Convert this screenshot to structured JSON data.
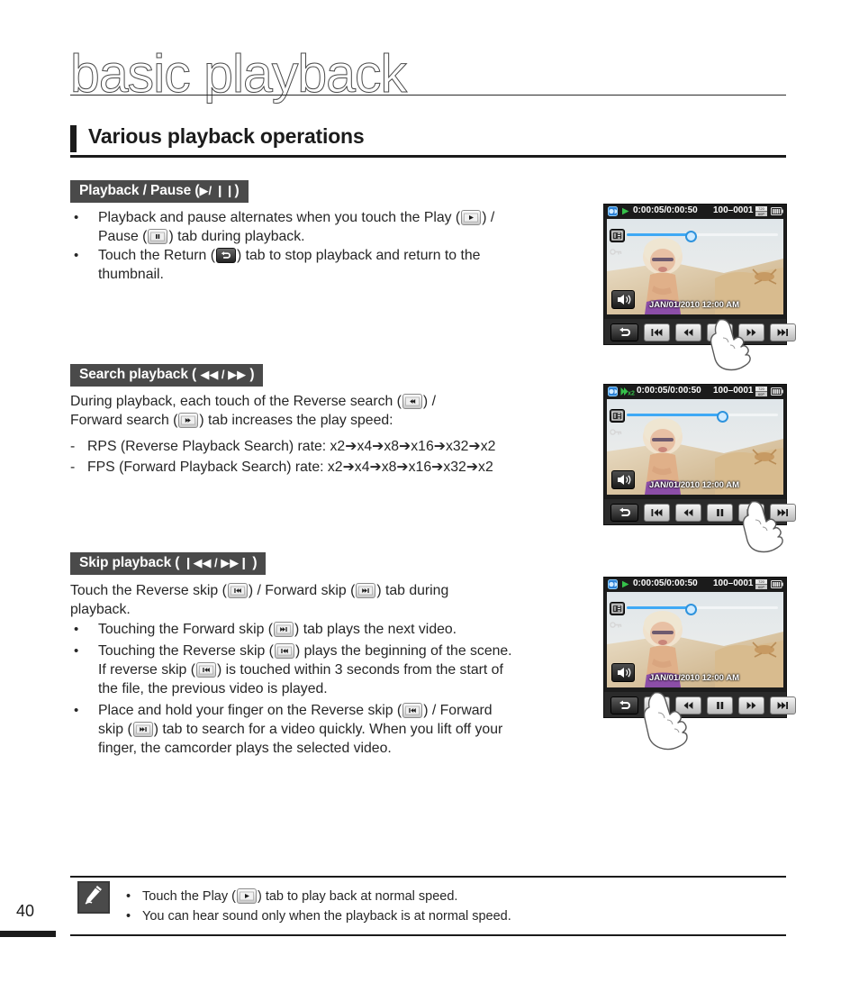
{
  "chapter": {
    "title": "basic playback"
  },
  "section": {
    "title": "Various playback operations"
  },
  "page": {
    "number": "40"
  },
  "subsections": [
    {
      "id": "playback-pause",
      "pill_label": "Playback / Pause (",
      "pill_glyphs": "▶/ ❙❙",
      "pill_close": ")",
      "bullets": [
        {
          "parts": [
            "Playback and pause alternates when you touch the Play (",
            ") /",
            "Pause (",
            ") tab during playback."
          ]
        },
        {
          "parts": [
            "Touch the Return (",
            ") tab to stop playback and return to the",
            "thumbnail."
          ]
        }
      ]
    },
    {
      "id": "search-playback",
      "pill_label": "Search playback ( ",
      "pill_glyphs": "◀◀ / ▶▶",
      "pill_close": " )",
      "intro": [
        "During playback, each touch of the Reverse search (",
        ") /",
        "Forward search (",
        ") tab increases the play speed:"
      ],
      "dashes": [
        "RPS (Reverse Playback Search) rate: x2➔x4➔x8➔x16➔x32➔x2",
        "FPS (Forward Playback Search) rate: x2➔x4➔x8➔x16➔x32➔x2"
      ]
    },
    {
      "id": "skip-playback",
      "pill_label": "Skip playback ( ",
      "pill_glyphs": "❙◀◀ / ▶▶❙",
      "pill_close": " )",
      "intro": [
        "Touch the Reverse skip (",
        ") / Forward skip (",
        ") tab during",
        "playback."
      ],
      "bullets": [
        {
          "parts": [
            "Touching the Forward skip (",
            ") tab plays the next video."
          ]
        },
        {
          "parts": [
            "Touching the Reverse skip (",
            ") plays the beginning of the scene.",
            "If reverse skip (",
            ") is touched within 3 seconds from the start of",
            "the file, the previous video is played."
          ]
        },
        {
          "parts": [
            "Place and hold your finger on the Reverse skip (",
            ") / Forward",
            "skip (",
            ") tab to search for a video quickly. When you lift off your",
            "finger, the camcorder plays the selected video."
          ]
        }
      ]
    }
  ],
  "lcd": {
    "time": "0:00:05/0:00:50",
    "file_no": "100–0001",
    "resolution_badge": "720\n60P",
    "date_overlay": "JAN/01/2010  12:00 AM",
    "speed_badge": "x2",
    "buttons": [
      "return-tab",
      "reverse-skip-tab",
      "reverse-search-tab",
      "pause-tab",
      "forward-search-tab",
      "forward-skip-tab"
    ]
  },
  "lcd_screens": [
    {
      "id": "screen-playback-pause",
      "status_icon": "play-icon",
      "touched_button": "pause-tab"
    },
    {
      "id": "screen-search-playback",
      "status_icon": "forward-search-x2-icon",
      "touched_button": "forward-search-tab"
    },
    {
      "id": "screen-skip-playback",
      "status_icon": "play-icon",
      "touched_button": "reverse-skip-tab"
    }
  ],
  "note": {
    "bullets": [
      {
        "parts": [
          "Touch the Play (",
          ") tab to play back at normal speed."
        ]
      },
      {
        "parts": [
          "You can hear sound only when the playback is at normal speed."
        ]
      }
    ]
  }
}
